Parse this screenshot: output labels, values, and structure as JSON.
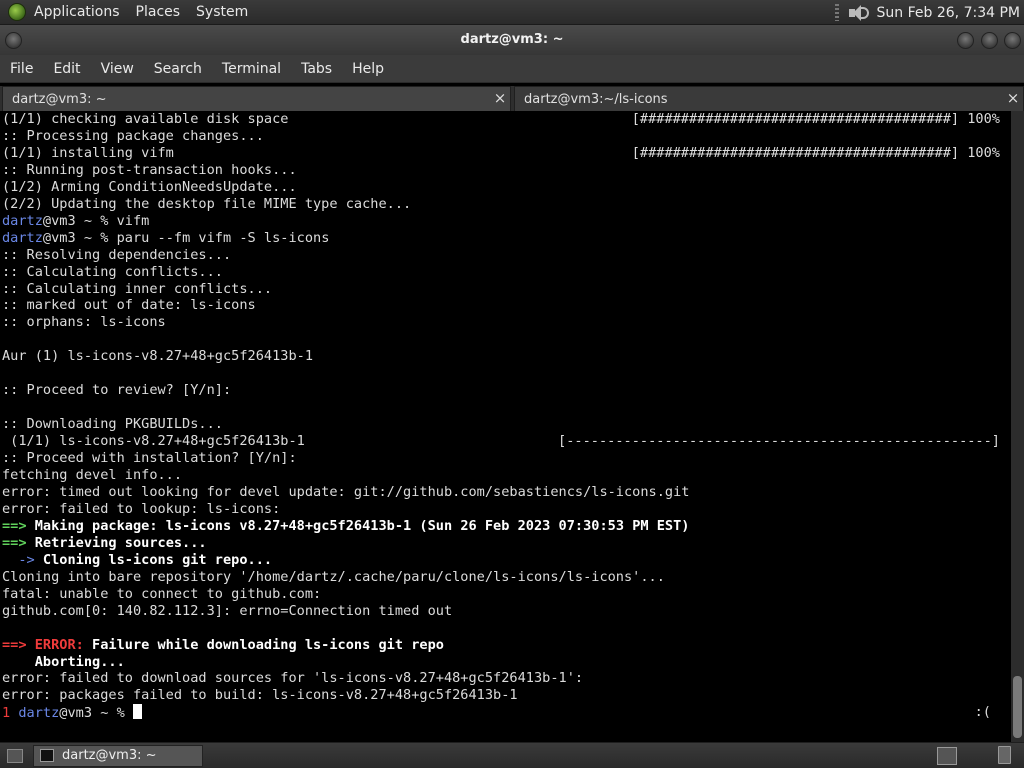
{
  "top_panel": {
    "menus": [
      "Applications",
      "Places",
      "System"
    ],
    "clock": "Sun Feb 26, 7:34 PM"
  },
  "window": {
    "title": "dartz@vm3: ~"
  },
  "menu_bar": [
    "File",
    "Edit",
    "View",
    "Search",
    "Terminal",
    "Tabs",
    "Help"
  ],
  "tabs": [
    {
      "label": "dartz@vm3: ~",
      "close": "×"
    },
    {
      "label": "dartz@vm3:~/ls-icons",
      "close": "×"
    }
  ],
  "terminal": {
    "lines": [
      {
        "segments": [
          {
            "text": "(1/1) checking available disk space",
            "style": ""
          }
        ],
        "right": "[######################################] 100%"
      },
      {
        "segments": [
          {
            "text": ":: Processing package changes...",
            "style": ""
          }
        ]
      },
      {
        "segments": [
          {
            "text": "(1/1) installing vifm",
            "style": ""
          }
        ],
        "right": "[######################################] 100%"
      },
      {
        "segments": [
          {
            "text": ":: Running post-transaction hooks...",
            "style": ""
          }
        ]
      },
      {
        "segments": [
          {
            "text": "(1/2) Arming ConditionNeedsUpdate...",
            "style": ""
          }
        ]
      },
      {
        "segments": [
          {
            "text": "(2/2) Updating the desktop file MIME type cache...",
            "style": ""
          }
        ]
      },
      {
        "segments": [
          {
            "text": "dartz",
            "style": "blue"
          },
          {
            "text": "@",
            "style": ""
          },
          {
            "text": "vm3",
            "style": ""
          },
          {
            "text": " ~ % vifm",
            "style": ""
          }
        ]
      },
      {
        "segments": [
          {
            "text": "dartz",
            "style": "blue"
          },
          {
            "text": "@",
            "style": ""
          },
          {
            "text": "vm3",
            "style": ""
          },
          {
            "text": " ~ % paru --fm vifm -S ls-icons",
            "style": ""
          }
        ]
      },
      {
        "segments": [
          {
            "text": ":: Resolving dependencies...",
            "style": ""
          }
        ]
      },
      {
        "segments": [
          {
            "text": ":: Calculating conflicts...",
            "style": ""
          }
        ]
      },
      {
        "segments": [
          {
            "text": ":: Calculating inner conflicts...",
            "style": ""
          }
        ]
      },
      {
        "segments": [
          {
            "text": ":: marked out of date: ls-icons",
            "style": ""
          }
        ]
      },
      {
        "segments": [
          {
            "text": ":: orphans: ls-icons",
            "style": ""
          }
        ]
      },
      {
        "segments": [
          {
            "text": "",
            "style": ""
          }
        ]
      },
      {
        "segments": [
          {
            "text": "Aur (1) ls-icons-v8.27+48+gc5f26413b-1",
            "style": ""
          }
        ]
      },
      {
        "segments": [
          {
            "text": "",
            "style": ""
          }
        ]
      },
      {
        "segments": [
          {
            "text": ":: Proceed to review? [Y/n]:",
            "style": ""
          }
        ]
      },
      {
        "segments": [
          {
            "text": "",
            "style": ""
          }
        ]
      },
      {
        "segments": [
          {
            "text": ":: Downloading PKGBUILDs...",
            "style": ""
          }
        ]
      },
      {
        "segments": [
          {
            "text": " (1/1) ls-icons-v8.27+48+gc5f26413b-1",
            "style": ""
          }
        ],
        "right": "[----------------------------------------------------]"
      },
      {
        "segments": [
          {
            "text": ":: Proceed with installation? [Y/n]:",
            "style": ""
          }
        ]
      },
      {
        "segments": [
          {
            "text": "fetching devel info...",
            "style": ""
          }
        ]
      },
      {
        "segments": [
          {
            "text": "error: timed out looking for devel update: git://github.com/sebastiencs/ls-icons.git",
            "style": ""
          }
        ]
      },
      {
        "segments": [
          {
            "text": "error: failed to lookup: ls-icons:",
            "style": ""
          }
        ]
      },
      {
        "segments": [
          {
            "text": "==>",
            "style": "green"
          },
          {
            "text": " Making package: ls-icons v8.27+48+gc5f26413b-1 (Sun 26 Feb 2023 07:30:53 PM EST)",
            "style": "bold"
          }
        ]
      },
      {
        "segments": [
          {
            "text": "==>",
            "style": "green"
          },
          {
            "text": " Retrieving sources...",
            "style": "bold"
          }
        ]
      },
      {
        "segments": [
          {
            "text": "  ->",
            "style": "blue"
          },
          {
            "text": " Cloning ls-icons git repo...",
            "style": "bold"
          }
        ]
      },
      {
        "segments": [
          {
            "text": "Cloning into bare repository '/home/dartz/.cache/paru/clone/ls-icons/ls-icons'...",
            "style": ""
          }
        ]
      },
      {
        "segments": [
          {
            "text": "fatal: unable to connect to github.com:",
            "style": ""
          }
        ]
      },
      {
        "segments": [
          {
            "text": "github.com[0: 140.82.112.3]: errno=Connection timed out",
            "style": ""
          }
        ]
      },
      {
        "segments": [
          {
            "text": "",
            "style": ""
          }
        ]
      },
      {
        "segments": [
          {
            "text": "==> ERROR:",
            "style": "red"
          },
          {
            "text": " Failure while downloading ls-icons git repo",
            "style": "bold"
          }
        ]
      },
      {
        "segments": [
          {
            "text": "    Aborting...",
            "style": "bold"
          }
        ]
      },
      {
        "segments": [
          {
            "text": "error: failed to download sources for 'ls-icons-v8.27+48+gc5f26413b-1':",
            "style": ""
          }
        ]
      },
      {
        "segments": [
          {
            "text": "error: packages failed to build: ls-icons-v8.27+48+gc5f26413b-1",
            "style": ""
          }
        ]
      }
    ],
    "prompt": {
      "exit_code": "1",
      "user": "dartz",
      "at": "@",
      "host": "vm3",
      "rest": " ~ % ",
      "right": ":("
    }
  },
  "taskbar": {
    "task_label": "dartz@vm3: ~"
  },
  "colors": {
    "prompt_user": "#6a87e6",
    "arrow_green": "#61d25c",
    "error_red": "#ef3b3b"
  }
}
